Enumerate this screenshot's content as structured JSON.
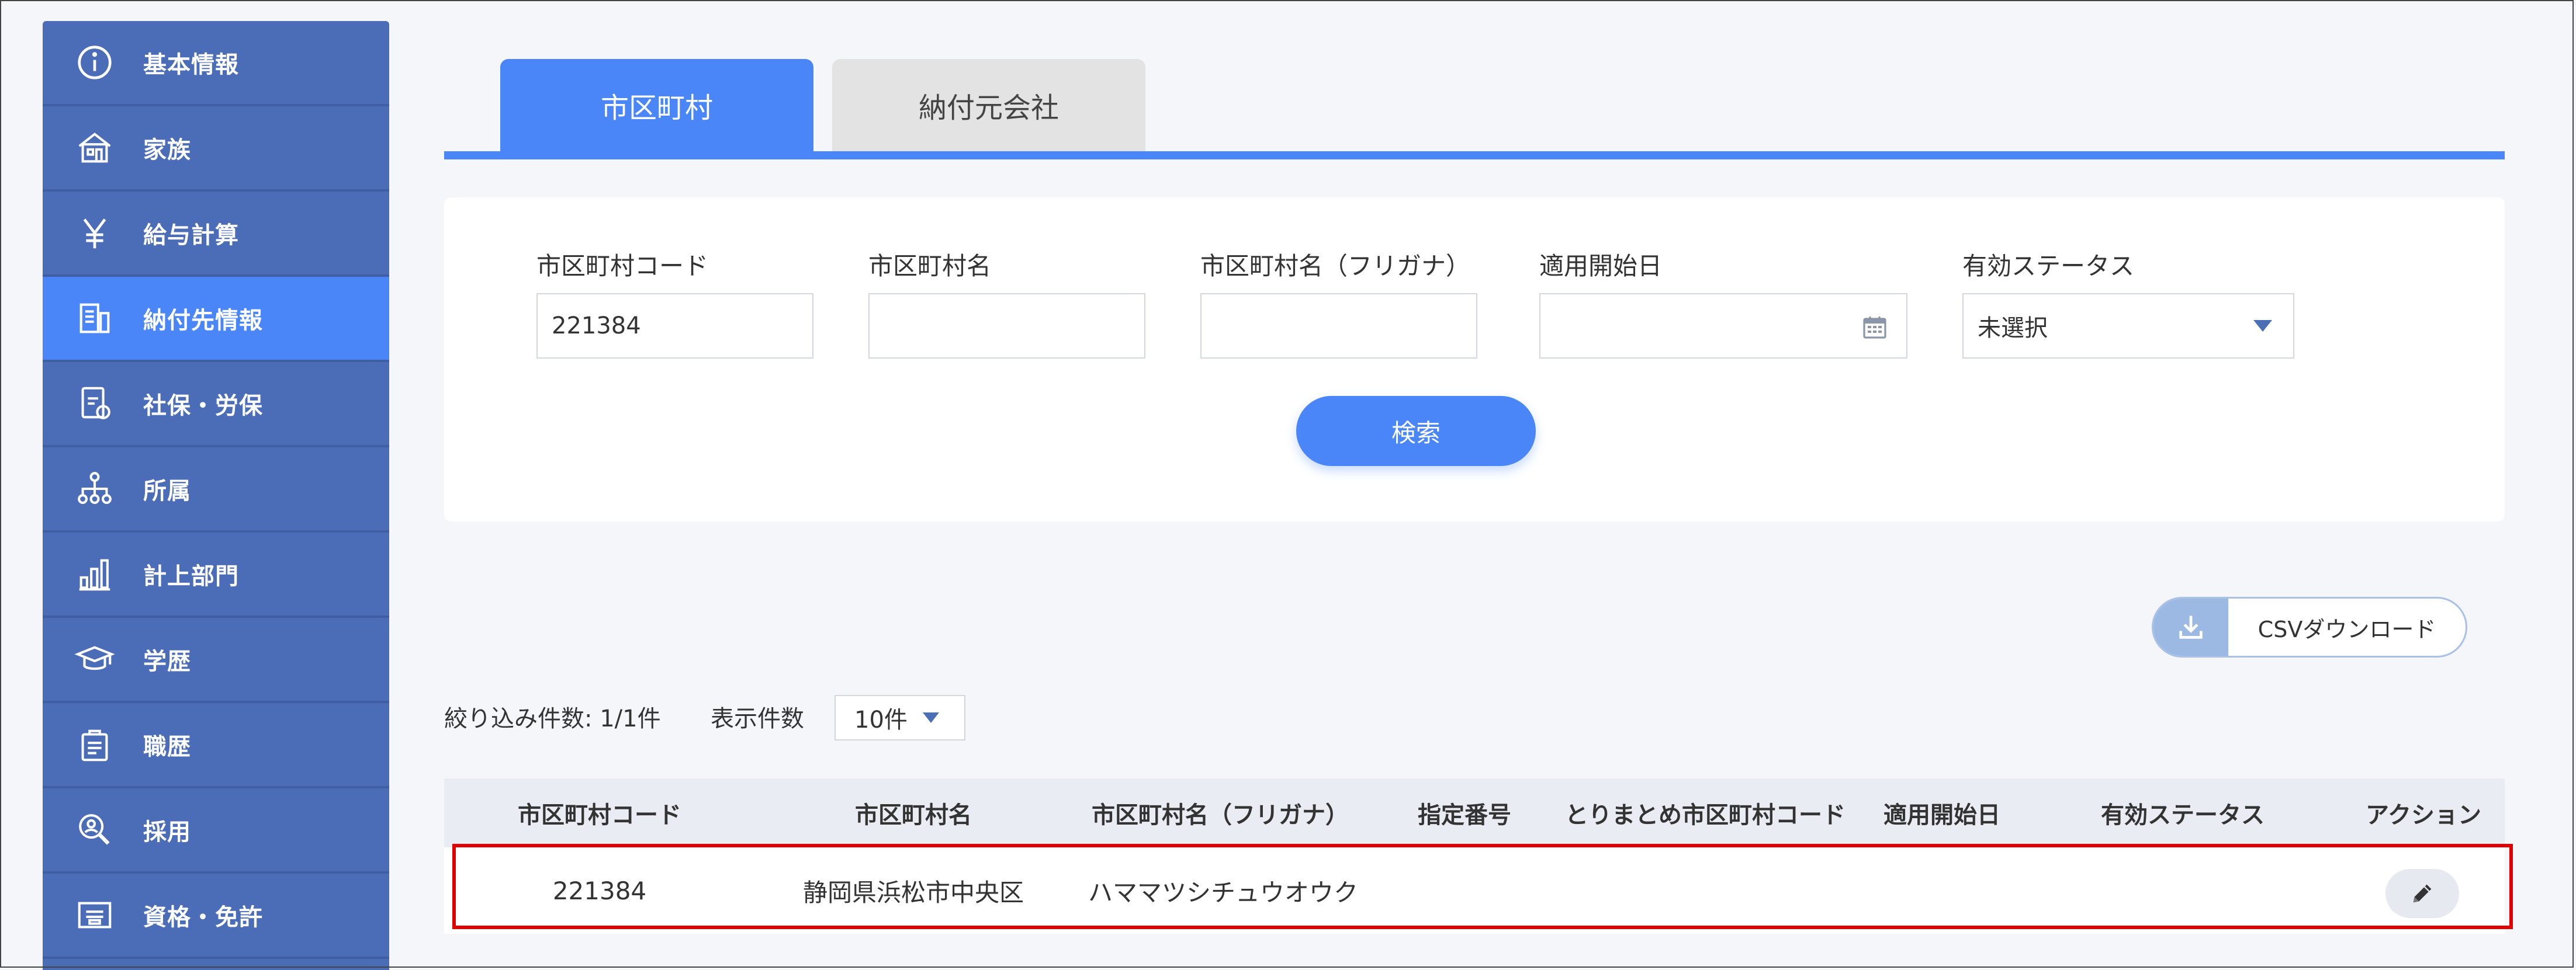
{
  "sidebar": {
    "items": [
      {
        "label": "基本情報",
        "icon": "info-circle-icon"
      },
      {
        "label": "家族",
        "icon": "house-icon"
      },
      {
        "label": "給与計算",
        "icon": "yen-icon"
      },
      {
        "label": "納付先情報",
        "icon": "building-document-icon",
        "active": true
      },
      {
        "label": "社保・労保",
        "icon": "insurance-document-icon"
      },
      {
        "label": "所属",
        "icon": "org-chart-icon"
      },
      {
        "label": "計上部門",
        "icon": "bar-chart-icon"
      },
      {
        "label": "学歴",
        "icon": "graduation-cap-icon"
      },
      {
        "label": "職歴",
        "icon": "briefcase-document-icon"
      },
      {
        "label": "採用",
        "icon": "magnifier-person-icon"
      },
      {
        "label": "資格・免許",
        "icon": "certificate-icon"
      }
    ]
  },
  "tabs": [
    {
      "label": "市区町村",
      "active": true
    },
    {
      "label": "納付元会社",
      "active": false
    }
  ],
  "search": {
    "city_code": {
      "label": "市区町村コード",
      "value": "221384"
    },
    "city_name": {
      "label": "市区町村名",
      "value": ""
    },
    "city_kana": {
      "label": "市区町村名（フリガナ）",
      "value": ""
    },
    "start_date": {
      "label": "適用開始日",
      "value": ""
    },
    "status": {
      "label": "有効ステータス",
      "value": "未選択"
    },
    "button": "検索"
  },
  "csv_button": "CSVダウンロード",
  "results": {
    "count_label": "絞り込み件数: 1/1件",
    "per_page_label": "表示件数",
    "per_page_value": "10件"
  },
  "table": {
    "headers": [
      "市区町村コード",
      "市区町村名",
      "市区町村名（フリガナ）",
      "指定番号",
      "とりまとめ市区町村コード",
      "適用開始日",
      "有効ステータス",
      "アクション"
    ],
    "rows": [
      {
        "code": "221384",
        "name": "静岡県浜松市中央区",
        "kana": "ハママツシチュウオウク",
        "designation": "",
        "summary_code": "",
        "start_date": "",
        "status": ""
      }
    ]
  },
  "colors": {
    "sidebar": "#4b6cb7",
    "accent": "#4a86f7",
    "highlight": "#e00000"
  }
}
